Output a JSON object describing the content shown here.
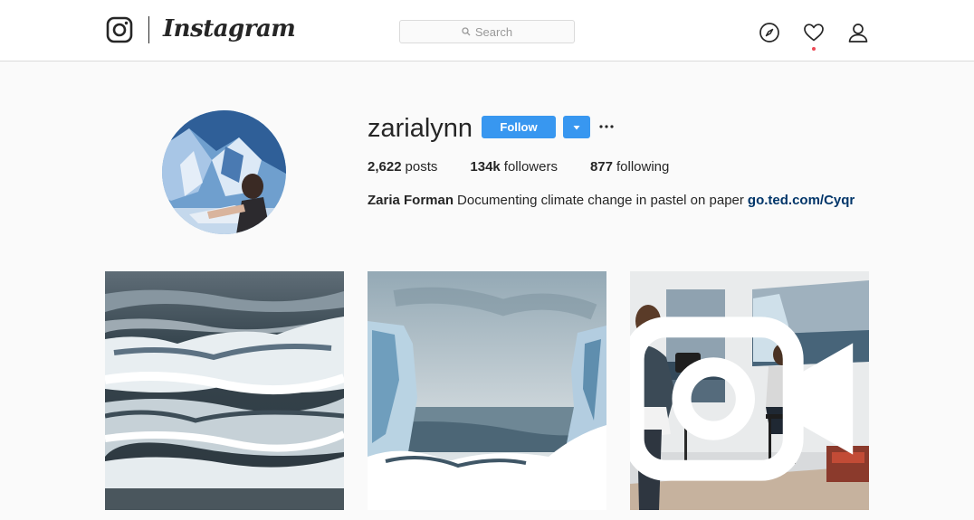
{
  "nav": {
    "brand": "Instagram",
    "search_placeholder": "Search",
    "icons": [
      "instagram-glyph-icon",
      "search-icon",
      "compass-icon",
      "heart-icon",
      "profile-icon"
    ]
  },
  "profile": {
    "username": "zarialynn",
    "follow_label": "Follow",
    "stats": {
      "posts_count": "2,622",
      "posts_label": "posts",
      "followers_count": "134k",
      "followers_label": "followers",
      "following_count": "877",
      "following_label": "following"
    },
    "bio": {
      "full_name": "Zaria Forman",
      "text": "Documenting climate change in pastel on paper",
      "link": "go.ted.com/Cyqr"
    }
  },
  "posts": [
    {
      "kind": "image"
    },
    {
      "kind": "image"
    },
    {
      "kind": "video",
      "badge_icon": "video-camera-icon"
    }
  ],
  "colors": {
    "accent": "#3897f0",
    "link": "#003569",
    "notification": "#ed4956",
    "background": "#fafafa"
  }
}
